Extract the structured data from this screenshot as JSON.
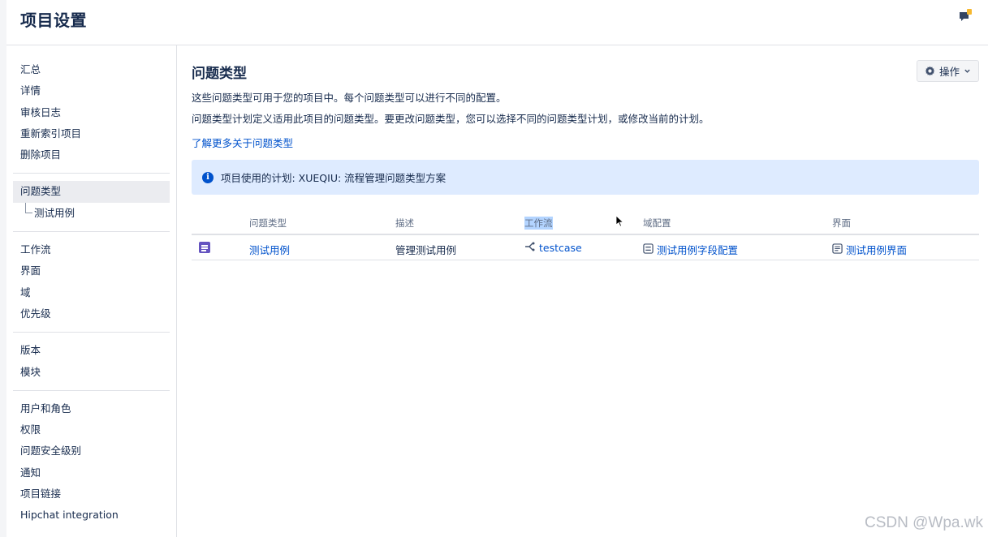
{
  "header": {
    "title": "项目设置"
  },
  "sidebar": {
    "groups": [
      {
        "items": [
          "汇总",
          "详情",
          "审核日志",
          "重新索引项目",
          "删除项目"
        ]
      },
      {
        "items": [
          "问题类型",
          "测试用例"
        ]
      },
      {
        "items": [
          "工作流",
          "界面",
          "域",
          "优先级"
        ]
      },
      {
        "items": [
          "版本",
          "模块"
        ]
      },
      {
        "items": [
          "用户和角色",
          "权限",
          "问题安全级别",
          "通知",
          "项目链接",
          "Hipchat integration"
        ]
      }
    ]
  },
  "main": {
    "title": "问题类型",
    "actions_label": "操作",
    "desc1": "这些问题类型可用于您的项目中。每个问题类型可以进行不同的配置。",
    "desc2": "问题类型计划定义适用此项目的问题类型。要更改问题类型，您可以选择不同的问题类型计划，或修改当前的计划。",
    "learn_more": "了解更多关于问题类型",
    "info": "项目使用的计划: XUEQIU: 流程管理问题类型方案",
    "table": {
      "headers": [
        "问题类型",
        "描述",
        "工作流",
        "域配置",
        "界面"
      ],
      "rows": [
        {
          "type": "测试用例",
          "description": "管理测试用例",
          "workflow": "testcase",
          "field_config": "测试用例字段配置",
          "screen": "测试用例界面"
        }
      ]
    }
  },
  "watermark": "CSDN @Wpa.wk",
  "icons": {
    "notification": "feedback-icon",
    "actions": "gear-icon",
    "info": "info-icon",
    "issue_type": "test-case-icon",
    "workflow": "workflow-icon",
    "field_config": "field-config-icon",
    "screen": "screen-icon"
  },
  "colors": {
    "link": "#0052cc",
    "info_bg": "#deebff",
    "issue_icon": "#6554c0"
  }
}
